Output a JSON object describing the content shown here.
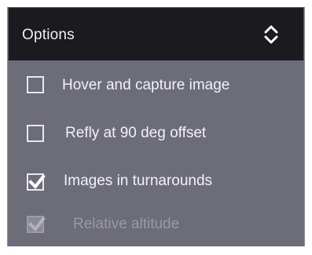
{
  "header": {
    "title": "Options",
    "expand_icon": "chevron-up-down-icon"
  },
  "options": [
    {
      "label": "Hover and capture image",
      "checked": false,
      "enabled": true
    },
    {
      "label": "Refly at 90 deg offset",
      "checked": false,
      "enabled": true
    },
    {
      "label": "Images in turnarounds",
      "checked": true,
      "enabled": true
    },
    {
      "label": "Relative altitude",
      "checked": true,
      "enabled": false
    }
  ],
  "colors": {
    "header_bg": "#1b1b1f",
    "panel_bg": "#6d6c79",
    "text": "#f2f2f4",
    "disabled_text": "#9a99a5"
  }
}
